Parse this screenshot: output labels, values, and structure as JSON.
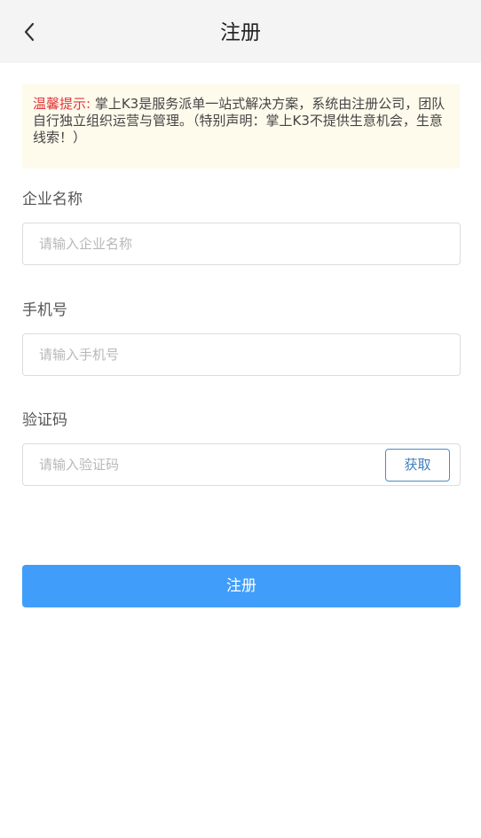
{
  "header": {
    "title": "注册",
    "back_icon": "chevron-left-icon"
  },
  "notice": {
    "label": "温馨提示:",
    "text": " 掌上K3是服务派单一站式解决方案，系统由注册公司，团队自行独立组织运营与管理。（特别声明：掌上K3不提供生意机会，生意线索！）"
  },
  "form": {
    "company": {
      "label": "企业名称",
      "placeholder": "请输入企业名称",
      "value": ""
    },
    "phone": {
      "label": "手机号",
      "placeholder": "请输入手机号",
      "value": ""
    },
    "code": {
      "label": "验证码",
      "placeholder": "请输入验证码",
      "value": "",
      "button_label": "获取"
    }
  },
  "submit": {
    "label": "注册"
  },
  "colors": {
    "header_bg": "#f4f4f4",
    "notice_bg": "#fefaec",
    "notice_label": "#e0363b",
    "primary": "#419dfa",
    "code_button_border": "#4a8bc9"
  }
}
